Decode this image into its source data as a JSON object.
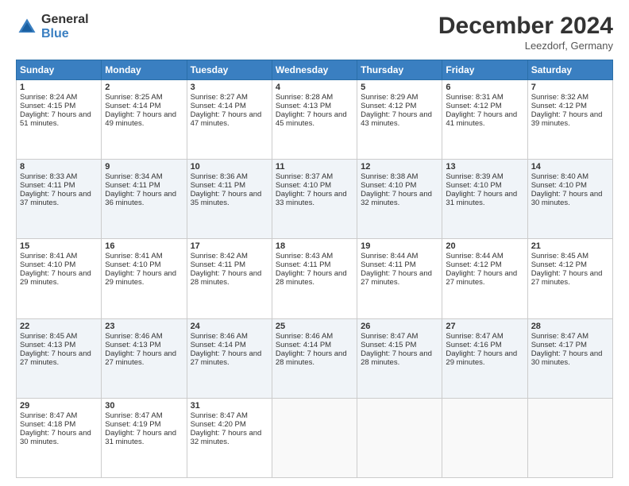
{
  "logo": {
    "general": "General",
    "blue": "Blue"
  },
  "header": {
    "month": "December 2024",
    "location": "Leezdorf, Germany"
  },
  "days": [
    "Sunday",
    "Monday",
    "Tuesday",
    "Wednesday",
    "Thursday",
    "Friday",
    "Saturday"
  ],
  "weeks": [
    [
      {
        "day": 1,
        "sunrise": "8:24 AM",
        "sunset": "4:15 PM",
        "daylight": "7 hours and 51 minutes."
      },
      {
        "day": 2,
        "sunrise": "8:25 AM",
        "sunset": "4:14 PM",
        "daylight": "7 hours and 49 minutes."
      },
      {
        "day": 3,
        "sunrise": "8:27 AM",
        "sunset": "4:14 PM",
        "daylight": "7 hours and 47 minutes."
      },
      {
        "day": 4,
        "sunrise": "8:28 AM",
        "sunset": "4:13 PM",
        "daylight": "7 hours and 45 minutes."
      },
      {
        "day": 5,
        "sunrise": "8:29 AM",
        "sunset": "4:12 PM",
        "daylight": "7 hours and 43 minutes."
      },
      {
        "day": 6,
        "sunrise": "8:31 AM",
        "sunset": "4:12 PM",
        "daylight": "7 hours and 41 minutes."
      },
      {
        "day": 7,
        "sunrise": "8:32 AM",
        "sunset": "4:12 PM",
        "daylight": "7 hours and 39 minutes."
      }
    ],
    [
      {
        "day": 8,
        "sunrise": "8:33 AM",
        "sunset": "4:11 PM",
        "daylight": "7 hours and 37 minutes."
      },
      {
        "day": 9,
        "sunrise": "8:34 AM",
        "sunset": "4:11 PM",
        "daylight": "7 hours and 36 minutes."
      },
      {
        "day": 10,
        "sunrise": "8:36 AM",
        "sunset": "4:11 PM",
        "daylight": "7 hours and 35 minutes."
      },
      {
        "day": 11,
        "sunrise": "8:37 AM",
        "sunset": "4:10 PM",
        "daylight": "7 hours and 33 minutes."
      },
      {
        "day": 12,
        "sunrise": "8:38 AM",
        "sunset": "4:10 PM",
        "daylight": "7 hours and 32 minutes."
      },
      {
        "day": 13,
        "sunrise": "8:39 AM",
        "sunset": "4:10 PM",
        "daylight": "7 hours and 31 minutes."
      },
      {
        "day": 14,
        "sunrise": "8:40 AM",
        "sunset": "4:10 PM",
        "daylight": "7 hours and 30 minutes."
      }
    ],
    [
      {
        "day": 15,
        "sunrise": "8:41 AM",
        "sunset": "4:10 PM",
        "daylight": "7 hours and 29 minutes."
      },
      {
        "day": 16,
        "sunrise": "8:41 AM",
        "sunset": "4:10 PM",
        "daylight": "7 hours and 29 minutes."
      },
      {
        "day": 17,
        "sunrise": "8:42 AM",
        "sunset": "4:11 PM",
        "daylight": "7 hours and 28 minutes."
      },
      {
        "day": 18,
        "sunrise": "8:43 AM",
        "sunset": "4:11 PM",
        "daylight": "7 hours and 28 minutes."
      },
      {
        "day": 19,
        "sunrise": "8:44 AM",
        "sunset": "4:11 PM",
        "daylight": "7 hours and 27 minutes."
      },
      {
        "day": 20,
        "sunrise": "8:44 AM",
        "sunset": "4:12 PM",
        "daylight": "7 hours and 27 minutes."
      },
      {
        "day": 21,
        "sunrise": "8:45 AM",
        "sunset": "4:12 PM",
        "daylight": "7 hours and 27 minutes."
      }
    ],
    [
      {
        "day": 22,
        "sunrise": "8:45 AM",
        "sunset": "4:13 PM",
        "daylight": "7 hours and 27 minutes."
      },
      {
        "day": 23,
        "sunrise": "8:46 AM",
        "sunset": "4:13 PM",
        "daylight": "7 hours and 27 minutes."
      },
      {
        "day": 24,
        "sunrise": "8:46 AM",
        "sunset": "4:14 PM",
        "daylight": "7 hours and 27 minutes."
      },
      {
        "day": 25,
        "sunrise": "8:46 AM",
        "sunset": "4:14 PM",
        "daylight": "7 hours and 28 minutes."
      },
      {
        "day": 26,
        "sunrise": "8:47 AM",
        "sunset": "4:15 PM",
        "daylight": "7 hours and 28 minutes."
      },
      {
        "day": 27,
        "sunrise": "8:47 AM",
        "sunset": "4:16 PM",
        "daylight": "7 hours and 29 minutes."
      },
      {
        "day": 28,
        "sunrise": "8:47 AM",
        "sunset": "4:17 PM",
        "daylight": "7 hours and 30 minutes."
      }
    ],
    [
      {
        "day": 29,
        "sunrise": "8:47 AM",
        "sunset": "4:18 PM",
        "daylight": "7 hours and 30 minutes."
      },
      {
        "day": 30,
        "sunrise": "8:47 AM",
        "sunset": "4:19 PM",
        "daylight": "7 hours and 31 minutes."
      },
      {
        "day": 31,
        "sunrise": "8:47 AM",
        "sunset": "4:20 PM",
        "daylight": "7 hours and 32 minutes."
      },
      null,
      null,
      null,
      null
    ]
  ]
}
